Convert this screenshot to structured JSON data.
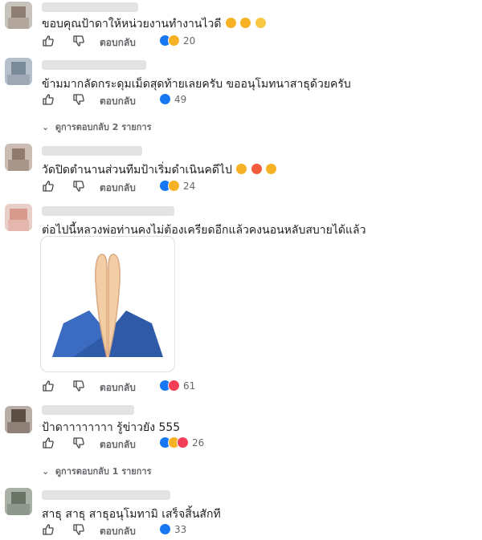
{
  "actions": {
    "reply_label": "ตอบกลับ"
  },
  "comments": [
    {
      "text": "ขอบคุณป้าดาให้หน่วยงานทำงานไวดี",
      "text_emojis": [
        "rofl",
        "rofl",
        "astonished"
      ],
      "reactions": [
        "like",
        "haha"
      ],
      "count": "20"
    },
    {
      "text": "ข้ามมากลัดกระดุมเม็ดสุดท้ายเลยครับ ขออนุโมทนาสาธุด้วยครับ",
      "reactions": [
        "like"
      ],
      "count": "49"
    },
    {
      "text": "วัดปิดตำนานส่วนทีมป้าเริ่มดำเนินคดีไป",
      "text_emojis": [
        "joy",
        "heart-eyes",
        "joy"
      ],
      "reactions": [
        "like",
        "haha"
      ],
      "count": "24"
    },
    {
      "text": "ต่อไปนี้หลวงพ่อท่านคงไม่ต้องเครียดอีกแล้วคงนอนหลับสบายได้แล้ว",
      "sticker": "folded-hands",
      "reactions": [
        "like",
        "love"
      ],
      "count": "61"
    },
    {
      "text": "ป้าดาาาาาาาา รู้ข่าวยัง 555",
      "reactions": [
        "like",
        "haha",
        "love"
      ],
      "count": "26"
    },
    {
      "text": "สาธุ สาธุ สาธุอนุโมทามิ เสร็จสิ้นสักที",
      "reactions": [
        "like"
      ],
      "count": "33"
    }
  ],
  "reply_threads": [
    {
      "label": "ดูการตอบกลับ 2 รายการ"
    },
    {
      "label": "ดูการตอบกลับ 1 รายการ"
    }
  ],
  "colors": {
    "like": "#1877f2",
    "haha": "#f7b125",
    "love": "#f33e58",
    "secondary_text": "#65676b"
  }
}
